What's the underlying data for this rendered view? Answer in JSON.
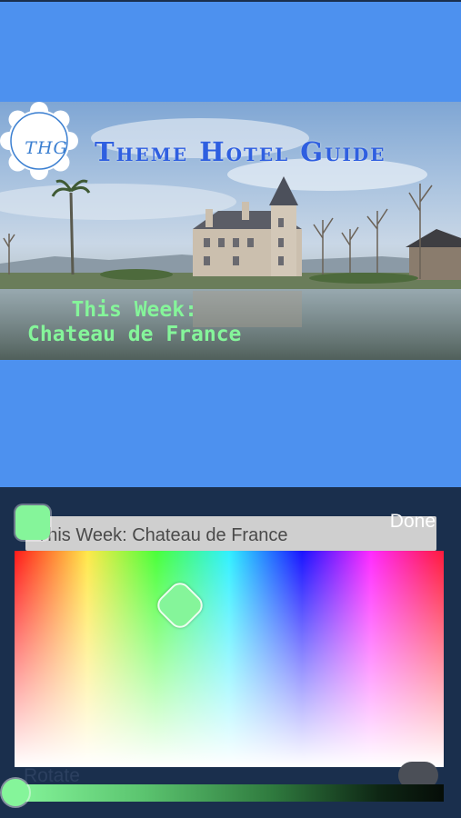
{
  "banner": {
    "logo_text": "THG",
    "title": "Theme Hotel Guide",
    "overlay_line1": "This Week:",
    "overlay_line2": "Chateau de France"
  },
  "editor": {
    "done_label": "Done",
    "text_value": "This Week: Chateau de France",
    "selected_color": "#85f59a",
    "rotate_label": "Rotate"
  },
  "colors": {
    "background": "#4d91ef",
    "panel": "#1a2f4d",
    "overlay_text": "#85f59a",
    "title": "#2f5fe0"
  }
}
